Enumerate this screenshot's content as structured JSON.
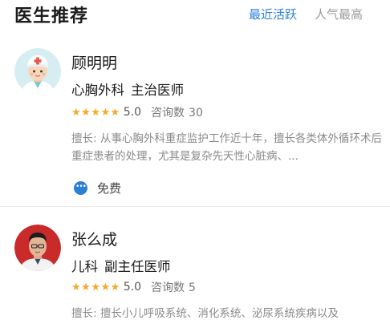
{
  "header": {
    "title": "医生推荐",
    "tabs": [
      {
        "label": "最近活跃",
        "active": true
      },
      {
        "label": "人气最高",
        "active": false
      }
    ]
  },
  "colors": {
    "accent": "#2b7fd9",
    "star": "#f7a826",
    "muted": "#8a8a8a"
  },
  "doctors": [
    {
      "name": "顾明明",
      "department": "心胸外科",
      "rank": "主治医师",
      "rating": "5.0",
      "stars": 5,
      "consult_label": "咨询数",
      "consult_count": "30",
      "specialty_label": "擅长:",
      "specialty": "从事心胸外科重症监护工作近十年，擅长各类体外循环术后重症患者的处理，尤其是复杂先天性心脏病、...",
      "fee_icon": "chat-bubble-icon",
      "fee": "免费"
    },
    {
      "name": "张么成",
      "department": "儿科",
      "rank": "副主任医师",
      "rating": "5.0",
      "stars": 5,
      "consult_label": "咨询数",
      "consult_count": "5",
      "specialty_label": "擅长:",
      "specialty": "擅长小儿呼吸系统、消化系统、泌尿系统疾病以及"
    }
  ]
}
